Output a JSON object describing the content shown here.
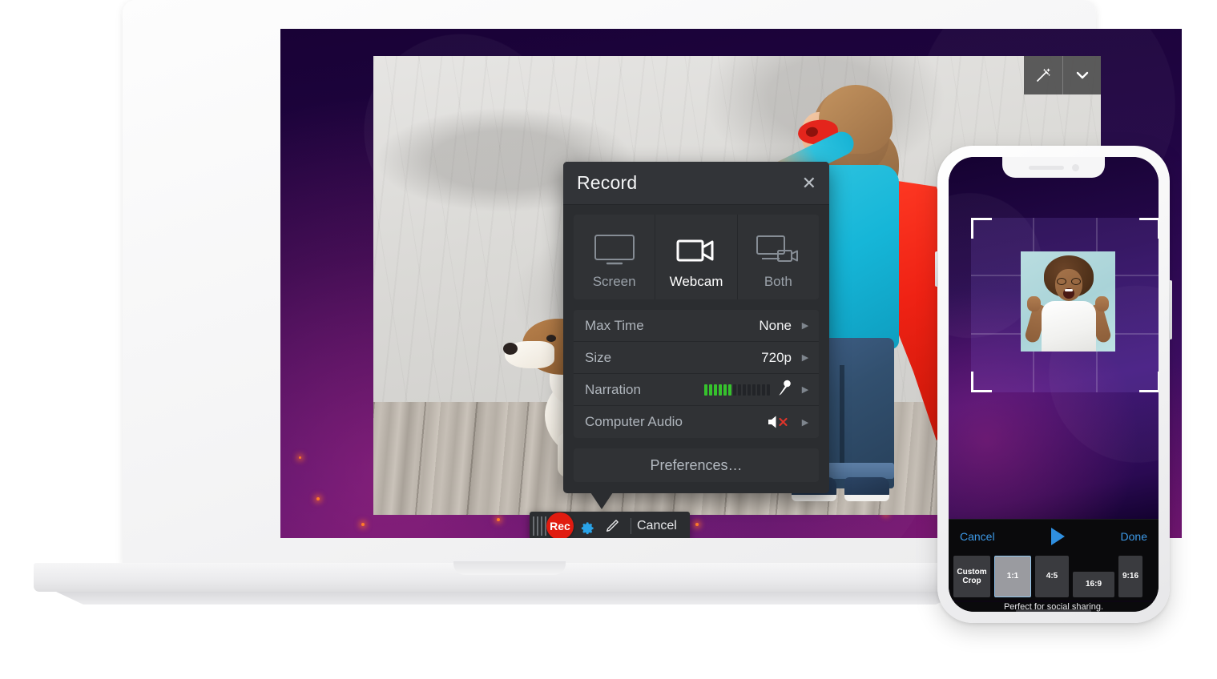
{
  "record_panel": {
    "title": "Record",
    "close_icon": "close-icon",
    "modes": [
      {
        "label": "Screen",
        "icon": "monitor-icon",
        "active": false
      },
      {
        "label": "Webcam",
        "icon": "video-camera-icon",
        "active": true
      },
      {
        "label": "Both",
        "icon": "monitor-camera-icon",
        "active": false
      }
    ],
    "options": [
      {
        "name": "Max Time",
        "value": "None",
        "type": "value"
      },
      {
        "name": "Size",
        "value": "720p",
        "type": "value"
      },
      {
        "name": "Narration",
        "value": "",
        "type": "meter",
        "meter_lit": 6,
        "meter_total": 14,
        "icon": "microphone-icon"
      },
      {
        "name": "Computer Audio",
        "value": "",
        "type": "muted",
        "icon": "speaker-muted-icon"
      }
    ],
    "preferences_label": "Preferences…"
  },
  "rec_toolbar": {
    "grip_icon": "drag-handle-icon",
    "record_label": "Rec",
    "settings_icon": "gear-icon",
    "annotate_icon": "pencil-icon",
    "cancel_label": "Cancel"
  },
  "canvas_toolbar": {
    "magic_icon": "magic-wand-icon",
    "chevron_icon": "chevron-down-icon"
  },
  "phone": {
    "toolbar": {
      "cancel_label": "Cancel",
      "play_icon": "play-icon",
      "done_label": "Done"
    },
    "ratios": [
      {
        "label": "Custom\nCrop",
        "line1": "Custom",
        "line2": "Crop",
        "selected": false
      },
      {
        "label": "1:1",
        "selected": true
      },
      {
        "label": "4:5",
        "selected": false
      },
      {
        "label": "16:9",
        "selected": false
      },
      {
        "label": "9:16",
        "selected": false
      }
    ],
    "hint": "Perfect for social sharing."
  },
  "colors": {
    "record_red": "#e01b10",
    "gear_blue": "#29a3e8",
    "link_blue": "#3d9ae8",
    "meter_green": "#36c22d",
    "panel_bg": "#2b2d30",
    "selection_blue": "#8fc3ea"
  }
}
